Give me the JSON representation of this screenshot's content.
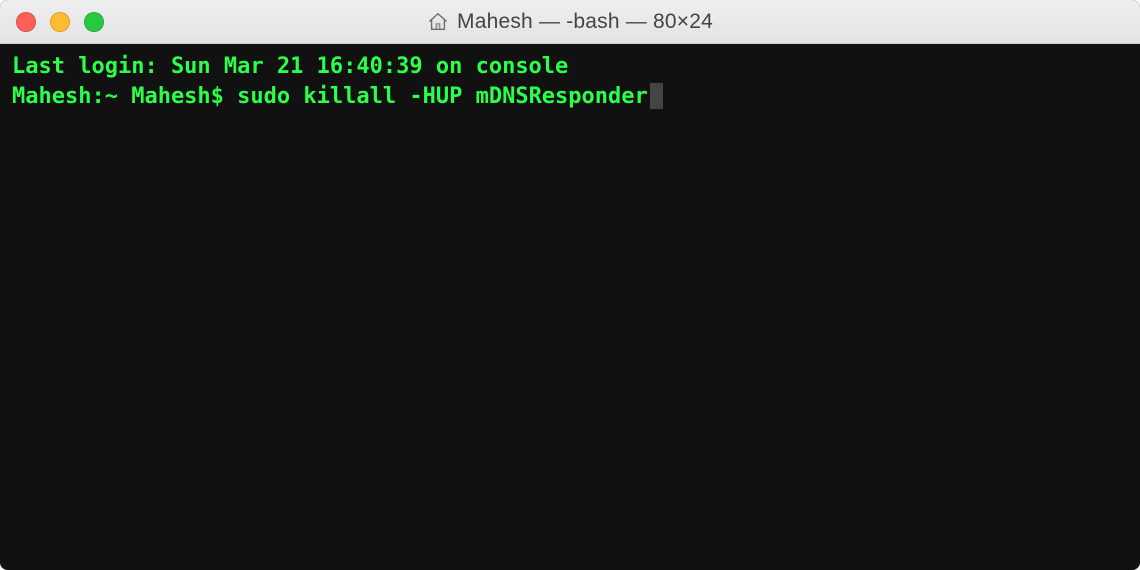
{
  "titlebar": {
    "title": "Mahesh — -bash — 80×24"
  },
  "terminal": {
    "last_login_line": "Last login: Sun Mar 21 16:40:39 on console",
    "prompt": "Mahesh:~ Mahesh$ ",
    "command": "sudo killall -HUP mDNSResponder"
  }
}
